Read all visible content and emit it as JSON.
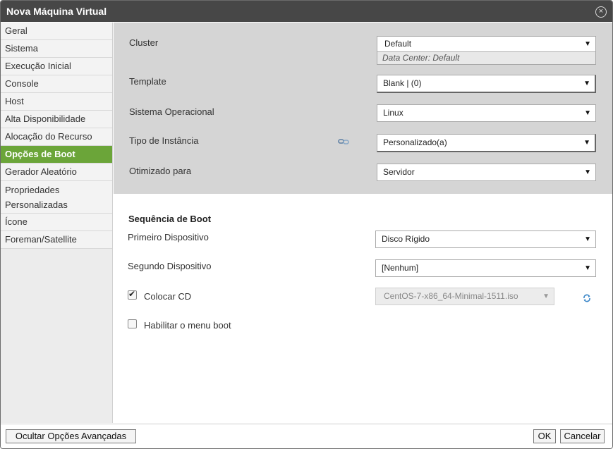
{
  "dialog": {
    "title": "Nova Máquina Virtual",
    "close_icon": "×"
  },
  "sidebar": {
    "items": [
      {
        "label": "Geral"
      },
      {
        "label": "Sistema"
      },
      {
        "label": "Execução Inicial"
      },
      {
        "label": "Console"
      },
      {
        "label": "Host"
      },
      {
        "label": "Alta Disponibilidade"
      },
      {
        "label": "Alocação do Recurso"
      },
      {
        "label": "Opções de Boot"
      },
      {
        "label": "Gerador Aleatório"
      },
      {
        "label_line1": "Propriedades",
        "label_line2": "Personalizadas"
      },
      {
        "label": "Ícone"
      },
      {
        "label": "Foreman/Satellite"
      }
    ],
    "active_index": 7
  },
  "top_fields": {
    "cluster": {
      "label": "Cluster",
      "value": "Default",
      "note": "Data Center: Default"
    },
    "template": {
      "label": "Template",
      "value": "Blank | (0)"
    },
    "os": {
      "label": "Sistema Operacional",
      "value": "Linux"
    },
    "instance_type": {
      "label": "Tipo de Instância",
      "value": "Personalizado(a)"
    },
    "optimized_for": {
      "label": "Otimizado para",
      "value": "Servidor"
    }
  },
  "boot": {
    "section_title": "Sequência de Boot",
    "first_device": {
      "label": "Primeiro Dispositivo",
      "value": "Disco Rígido"
    },
    "second_device": {
      "label": "Segundo Dispositivo",
      "value": "[Nenhum]"
    },
    "attach_cd": {
      "label": "Colocar CD",
      "checked": true,
      "value": "CentOS-7-x86_64-Minimal-1511.iso"
    },
    "boot_menu": {
      "label": "Habilitar o menu boot",
      "checked": false
    }
  },
  "footer": {
    "advanced_button": "Ocultar Opções Avançadas",
    "ok_button": "OK",
    "cancel_button": "Cancelar"
  },
  "colors": {
    "active_tab": "#6ba539",
    "titlebar": "#474747",
    "panel_gray": "#d5d5d5"
  },
  "icons": {
    "dropdown": "▼",
    "check": "✔",
    "link": "link-icon",
    "refresh": "refresh-icon"
  }
}
